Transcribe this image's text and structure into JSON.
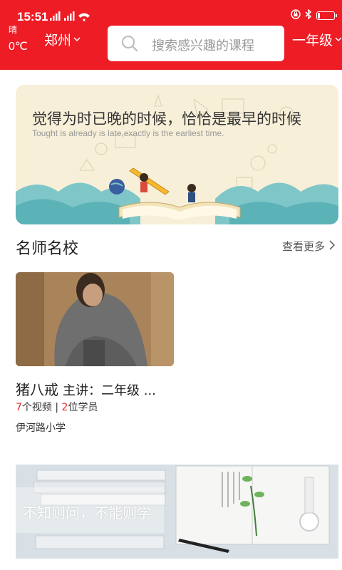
{
  "status_bar": {
    "time": "15:51",
    "signal_text": "⁴ᴳ▮▮▮ ▮▮▮",
    "battery_level": 0.15,
    "icons": [
      "lock-icon",
      "bluetooth-icon",
      "battery-icon",
      "wifi-icon"
    ]
  },
  "header": {
    "weather_condition": "晴",
    "temperature": "0℃",
    "city": "郑州",
    "search_placeholder": "搜索感兴趣的课程",
    "grade": "一年级",
    "accent_color": "#ee1c25"
  },
  "banner": {
    "title": "觉得为时已晚的时候，恰恰是最早的时候",
    "subtitle": "Tought is already is late,exactly is the earliest time."
  },
  "section": {
    "title": "名师名校",
    "more_label": "查看更多"
  },
  "teacher_card": {
    "name": "猪八戒",
    "lecture": "主讲：二年级 ...",
    "video_count": "7",
    "video_suffix": "个视频",
    "separator": " | ",
    "student_count": "2",
    "student_suffix": "位学员",
    "school": "伊河路小学"
  },
  "bottom_banner": {
    "text": "不知则问，不能则学"
  }
}
